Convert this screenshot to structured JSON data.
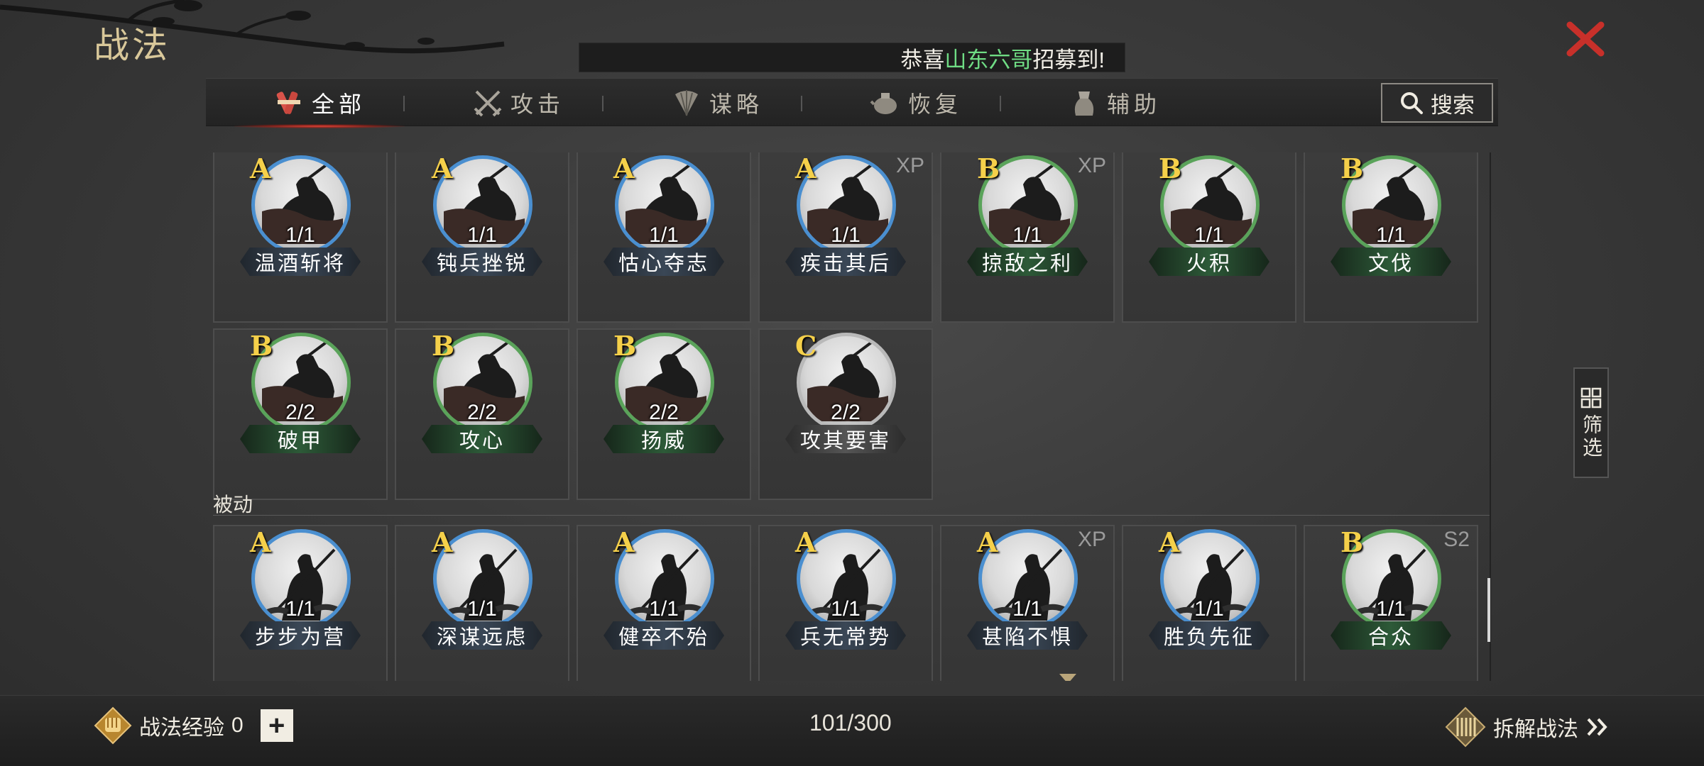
{
  "page": {
    "title": "战法"
  },
  "ticker": {
    "prefix": "恭喜",
    "highlight": "山东六哥",
    "suffix": "招募到!"
  },
  "tabs": [
    {
      "label": "全部",
      "icon": "scroll-bundle-icon",
      "active": true
    },
    {
      "label": "攻击",
      "icon": "crossed-swords-icon",
      "active": false
    },
    {
      "label": "谋略",
      "icon": "feather-fan-icon",
      "active": false
    },
    {
      "label": "恢复",
      "icon": "medicine-pot-icon",
      "active": false
    },
    {
      "label": "辅助",
      "icon": "supply-bag-icon",
      "active": false
    }
  ],
  "search": {
    "label": "搜索"
  },
  "filter": {
    "label": "筛选"
  },
  "active_skills": [
    {
      "grade": "A",
      "name": "温酒斩将",
      "count": "1/1",
      "tag": ""
    },
    {
      "grade": "A",
      "name": "钝兵挫锐",
      "count": "1/1",
      "tag": ""
    },
    {
      "grade": "A",
      "name": "怙心夺志",
      "count": "1/1",
      "tag": ""
    },
    {
      "grade": "A",
      "name": "疾击其后",
      "count": "1/1",
      "tag": "XP"
    },
    {
      "grade": "B",
      "name": "掠敌之利",
      "count": "1/1",
      "tag": "XP"
    },
    {
      "grade": "B",
      "name": "火积",
      "count": "1/1",
      "tag": ""
    },
    {
      "grade": "B",
      "name": "文伐",
      "count": "1/1",
      "tag": ""
    },
    {
      "grade": "B",
      "name": "破甲",
      "count": "2/2",
      "tag": ""
    },
    {
      "grade": "B",
      "name": "攻心",
      "count": "2/2",
      "tag": ""
    },
    {
      "grade": "B",
      "name": "扬威",
      "count": "2/2",
      "tag": ""
    },
    {
      "grade": "C",
      "name": "攻其要害",
      "count": "2/2",
      "tag": ""
    }
  ],
  "passive_section": {
    "label": "被动"
  },
  "passive_skills": [
    {
      "grade": "A",
      "name": "步步为营",
      "count": "1/1",
      "tag": ""
    },
    {
      "grade": "A",
      "name": "深谋远虑",
      "count": "1/1",
      "tag": ""
    },
    {
      "grade": "A",
      "name": "健卒不殆",
      "count": "1/1",
      "tag": ""
    },
    {
      "grade": "A",
      "name": "兵无常势",
      "count": "1/1",
      "tag": ""
    },
    {
      "grade": "A",
      "name": "甚陷不惧",
      "count": "1/1",
      "tag": "XP"
    },
    {
      "grade": "A",
      "name": "胜负先征",
      "count": "1/1",
      "tag": ""
    },
    {
      "grade": "B",
      "name": "合众",
      "count": "1/1",
      "tag": "S2"
    }
  ],
  "footer": {
    "exp_label": "战法经验",
    "exp_value": "0",
    "plus": "+",
    "capacity": "101/300",
    "dismantle_label": "拆解战法"
  },
  "colors": {
    "grade_text": "#f5d04a",
    "tier_a_ring": "#4a8fd0",
    "tier_b_ring": "#5aa35a",
    "tier_c_ring": "#b9b9b9",
    "ticker_highlight": "#6fdc84",
    "close": "#c8302a",
    "tab_active_glow": "#e04236"
  }
}
